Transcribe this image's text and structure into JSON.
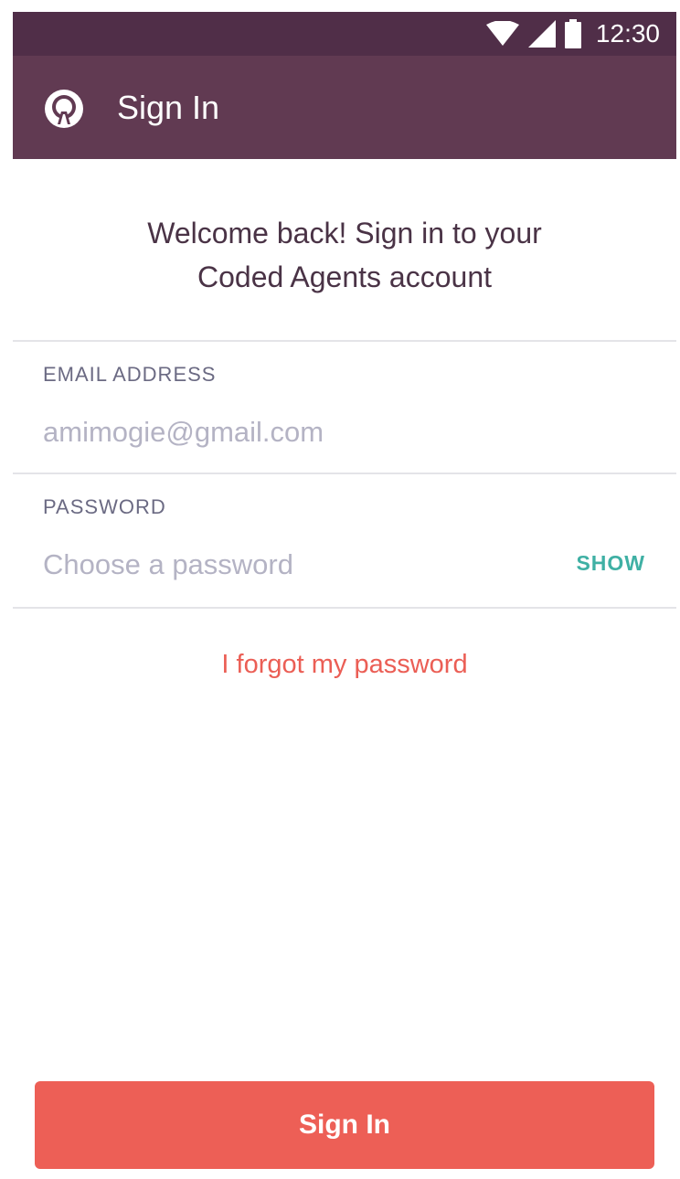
{
  "status_bar": {
    "time": "12:30",
    "icons": [
      "wifi-icon",
      "cellular-signal-icon",
      "battery-icon"
    ]
  },
  "app_bar": {
    "logo_icon": "app-logo-icon",
    "title": "Sign In"
  },
  "welcome": {
    "line1": "Welcome back! Sign in to your",
    "line2": "Coded Agents account"
  },
  "email": {
    "label": "EMAIL ADDRESS",
    "placeholder": "amimogie@gmail.com"
  },
  "password": {
    "label": "PASSWORD",
    "placeholder": "Choose a password",
    "toggle_label": "SHOW"
  },
  "forgot_password": "I forgot my password",
  "sign_in_button": "Sign In",
  "colors": {
    "status_bar": "#502e48",
    "app_bar": "#613a52",
    "primary_text": "#4a3346",
    "label_text": "#6b6a83",
    "placeholder": "#b4b3c4",
    "accent_teal": "#3fb0a4",
    "accent_red": "#ed5f56"
  }
}
